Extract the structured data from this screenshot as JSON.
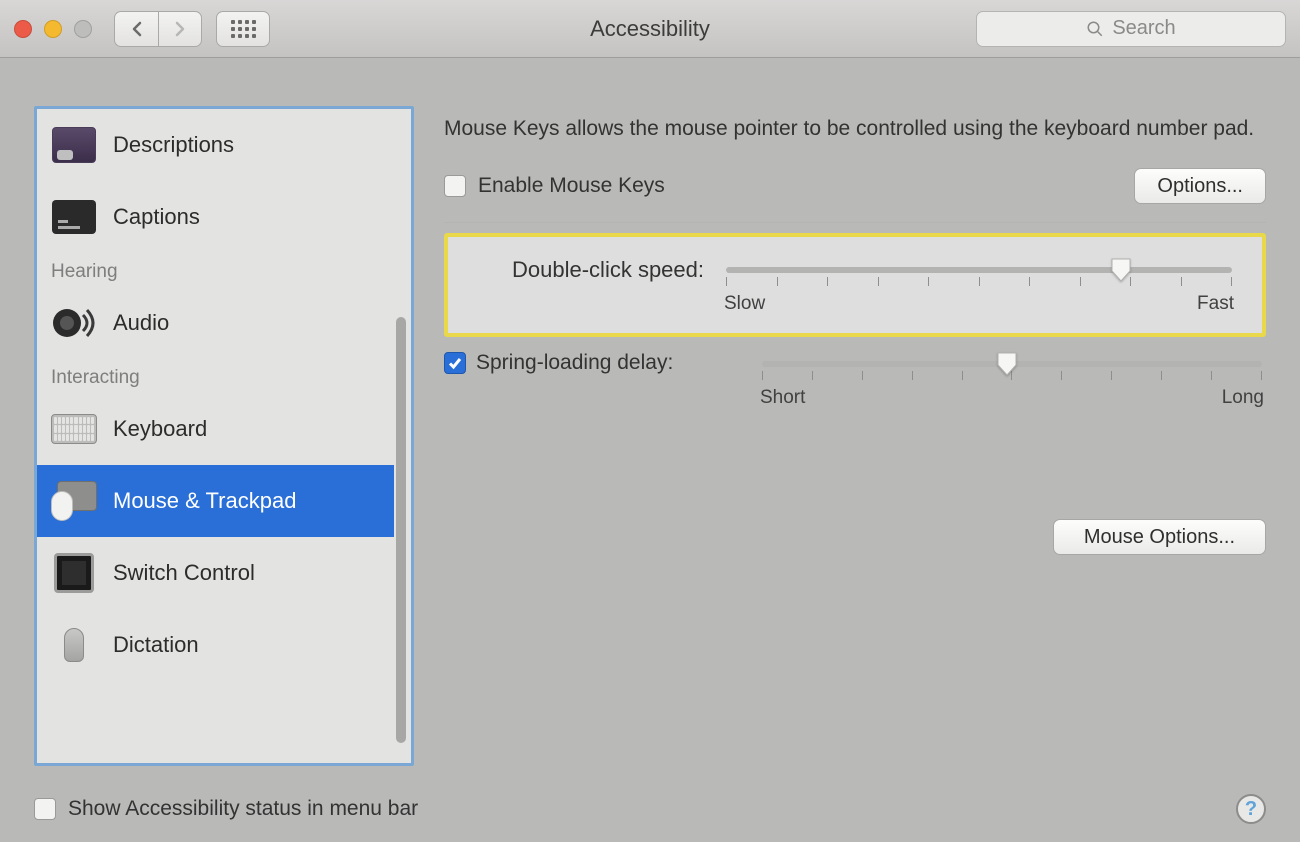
{
  "window": {
    "title": "Accessibility",
    "search_placeholder": "Search"
  },
  "sidebar": {
    "sections": {
      "hearing": "Hearing",
      "interacting": "Interacting"
    },
    "items": {
      "descriptions": "Descriptions",
      "captions": "Captions",
      "audio": "Audio",
      "keyboard": "Keyboard",
      "mouse_trackpad": "Mouse & Trackpad",
      "switch_control": "Switch Control",
      "dictation": "Dictation"
    },
    "selected": "mouse_trackpad"
  },
  "main": {
    "description": "Mouse Keys allows the mouse pointer to be controlled using the keyboard number pad.",
    "enable_mouse_keys_label": "Enable Mouse Keys",
    "enable_mouse_keys_checked": false,
    "options_button": "Options...",
    "double_click": {
      "label": "Double-click speed:",
      "min_label": "Slow",
      "max_label": "Fast",
      "ticks": 11,
      "value_percent": 78
    },
    "spring_loading": {
      "label": "Spring-loading delay:",
      "checked": true,
      "min_label": "Short",
      "max_label": "Long",
      "ticks": 11,
      "value_percent": 49
    },
    "mouse_options_button": "Mouse Options..."
  },
  "footer": {
    "show_status_label": "Show Accessibility status in menu bar",
    "show_status_checked": false,
    "help": "?"
  }
}
